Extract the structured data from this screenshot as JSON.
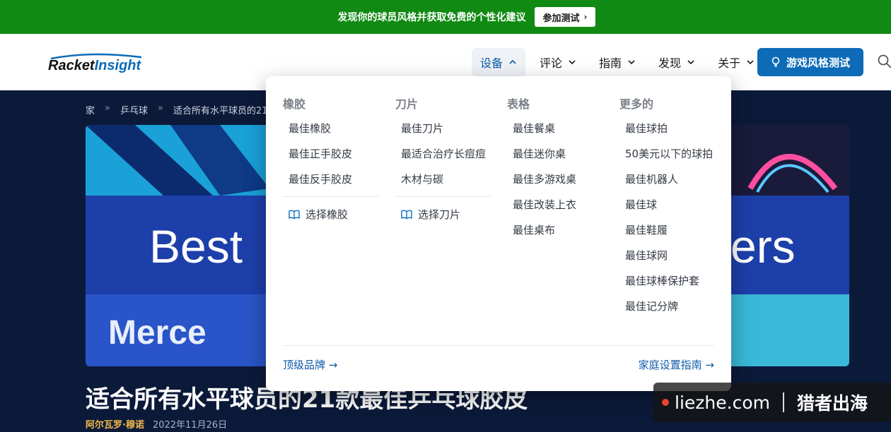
{
  "promo": {
    "text": "发现你的球员风格并获取免费的个性化建议",
    "button": "参加测试"
  },
  "header": {
    "logo": {
      "part1": "Racket",
      "part2": "Insight"
    },
    "nav": [
      {
        "label": "设备",
        "active": true
      },
      {
        "label": "评论"
      },
      {
        "label": "指南"
      },
      {
        "label": "发现"
      },
      {
        "label": "关于"
      }
    ],
    "cta": "游戏风格测试",
    "icons": {
      "cta": "lightbulb-icon",
      "search": "search-icon"
    }
  },
  "breadcrumb": [
    "家",
    "乒乓球",
    "适合所有水平球员的21"
  ],
  "hero": {
    "image_text_left": "Best",
    "image_text_right": "ers",
    "image_text_bottom": "Merce",
    "title": "适合所有水平球员的21款最佳乒乓球胶皮",
    "author": "阿尔瓦罗·穆诺",
    "date": "2022年11月26日"
  },
  "mega_menu": {
    "columns": [
      {
        "heading": "橡胶",
        "links": [
          "最佳橡胶",
          "最佳正手胶皮",
          "最佳反手胶皮"
        ],
        "choose": "选择橡胶"
      },
      {
        "heading": "刀片",
        "links": [
          "最适合治疗长痘痘",
          "木材与碳"
        ],
        "choose": "选择刀片",
        "link_first": "最佳刀片"
      },
      {
        "heading": "表格",
        "links": [
          "最佳餐桌",
          "最佳迷你桌",
          "最佳多游戏桌",
          "最佳改装上衣",
          "最佳桌布"
        ]
      },
      {
        "heading": "更多的",
        "links": [
          "最佳球拍",
          "50美元以下的球拍",
          "最佳机器人",
          "最佳球",
          "最佳鞋履",
          "最佳球网",
          "最佳球棒保护套",
          "最佳记分牌"
        ]
      }
    ],
    "footer_left": "顶级品牌 →",
    "footer_right": "家庭设置指南 →"
  },
  "watermark": {
    "site": "liezhe.com",
    "brand": "猎者出海"
  },
  "colors": {
    "promo": "#108a12",
    "accent": "#0d6bb8",
    "hero_bg": "#0c1a3a",
    "author": "#f2b84b"
  }
}
